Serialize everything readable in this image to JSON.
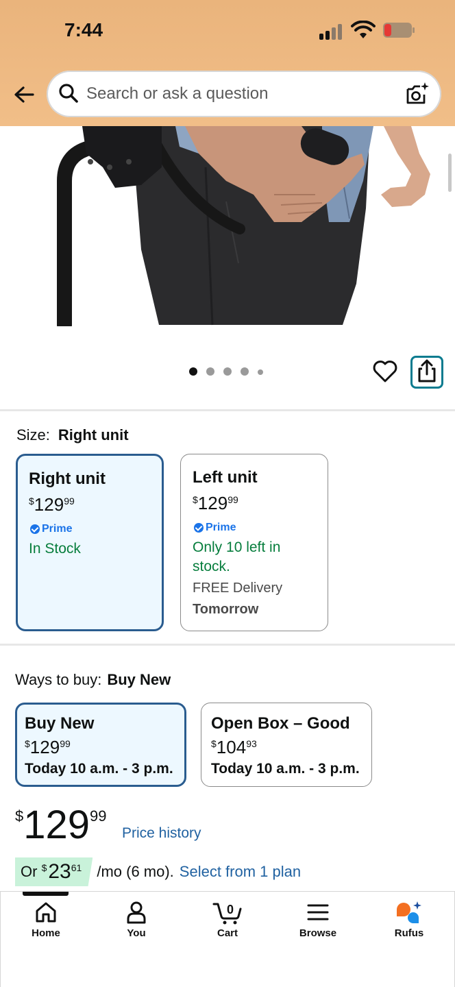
{
  "status_bar": {
    "time": "7:44"
  },
  "search": {
    "placeholder": "Search or ask a question"
  },
  "carousel": {
    "dot_count": 5,
    "active_index": 0
  },
  "size": {
    "label": "Size:",
    "selected": "Right unit",
    "options": [
      {
        "title": "Right unit",
        "price_currency": "$",
        "price_whole": "129",
        "price_cents": "99",
        "prime": "Prime",
        "stock": "In Stock",
        "delivery": "",
        "delivery_day": ""
      },
      {
        "title": "Left unit",
        "price_currency": "$",
        "price_whole": "129",
        "price_cents": "99",
        "prime": "Prime",
        "stock": "Only 10 left in stock.",
        "delivery": "FREE Delivery",
        "delivery_day": "Tomorrow"
      }
    ]
  },
  "ways_to_buy": {
    "label": "Ways to buy:",
    "selected": "Buy New",
    "options": [
      {
        "title": "Buy New",
        "price_currency": "$",
        "price_whole": "129",
        "price_cents": "99",
        "when": "Today 10 a.m. - 3 p.m."
      },
      {
        "title": "Open Box – Good",
        "price_currency": "$",
        "price_whole": "104",
        "price_cents": "93",
        "when": "Today 10 a.m. - 3 p.m."
      }
    ]
  },
  "price": {
    "currency": "$",
    "whole": "129",
    "cents": "99",
    "history_link": "Price history"
  },
  "installment": {
    "prefix": "Or",
    "currency": "$",
    "amount_whole": "23",
    "amount_cents": "61",
    "term": "/mo (6 mo).",
    "link": "Select from 1 plan"
  },
  "bottom_nav": {
    "items": [
      {
        "label": "Home",
        "icon": "home-icon"
      },
      {
        "label": "You",
        "icon": "person-icon"
      },
      {
        "label": "Cart",
        "icon": "cart-icon",
        "count": "0"
      },
      {
        "label": "Browse",
        "icon": "menu-icon"
      },
      {
        "label": "Rufus",
        "icon": "rufus-icon"
      }
    ]
  },
  "colors": {
    "header": "#eab47c",
    "selected_border": "#2a5c8f",
    "selected_bg": "#edf8ff",
    "link": "#2162a1",
    "stock_green": "#067d3c",
    "prime_blue": "#1a73e8",
    "installment_bg": "#c9f2da"
  }
}
